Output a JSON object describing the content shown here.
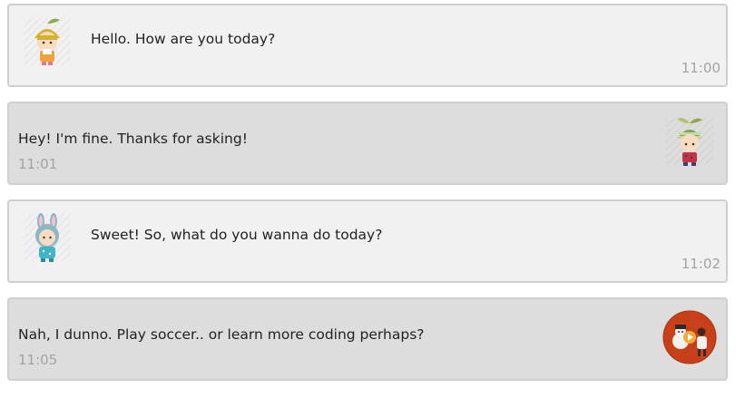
{
  "messages": [
    {
      "text": "Hello. How are you today?",
      "time": "11:00",
      "avatar": "yellow-sprout-hat-kid-icon"
    },
    {
      "text": "Hey! I'm fine. Thanks for asking!",
      "time": "11:01",
      "avatar": "green-striped-sprout-hat-kid-icon"
    },
    {
      "text": "Sweet! So, what do you wanna do today?",
      "time": "11:02",
      "avatar": "bunny-hood-kid-icon"
    },
    {
      "text": "Nah, I dunno. Play soccer.. or learn more coding perhaps?",
      "time": "11:05",
      "avatar": "circular-video-thumbnail-icon"
    }
  ],
  "colors": {
    "light_bubble": "#f1f1f1",
    "dark_bubble": "#dddddd",
    "border": "#cfcfcf",
    "text": "#222222",
    "time": "#a3a3a3",
    "thumbnail_bg": "#c8401a"
  }
}
